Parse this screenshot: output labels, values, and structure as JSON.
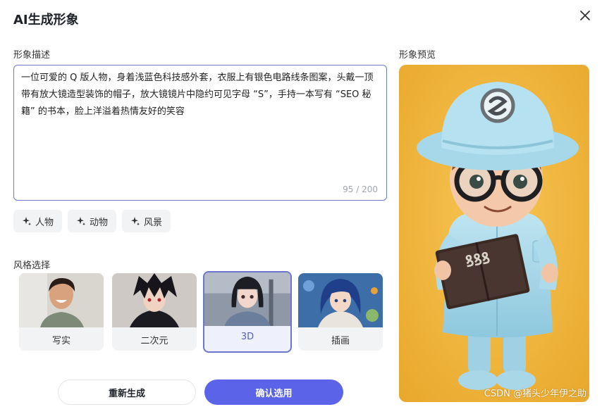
{
  "dialog": {
    "title": "AI生成形象"
  },
  "description": {
    "label": "形象描述",
    "value": "一位可爱的 Q 版人物，身着浅蓝色科技感外套，衣服上有银色电路线条图案，头戴一顶带有放大镜造型装饰的帽子，放大镜镜片中隐约可见字母 “S”，手持一本写有 “SEO 秘籍” 的书本，脸上洋溢着热情友好的笑容",
    "char_count": "95 / 200"
  },
  "chips": [
    {
      "label": "人物"
    },
    {
      "label": "动物"
    },
    {
      "label": "风景"
    }
  ],
  "style_section": {
    "label": "风格选择",
    "options": [
      {
        "label": "写实"
      },
      {
        "label": "二次元"
      },
      {
        "label": "3D",
        "selected": true
      },
      {
        "label": "插画"
      }
    ]
  },
  "preview": {
    "label": "形象预览",
    "book_text": "ꝸꝸꝸ"
  },
  "buttons": {
    "regenerate": "重新生成",
    "confirm": "确认选用"
  },
  "watermark": "CSDN @猪头少年伊之助",
  "colors": {
    "accent": "#5b63e8",
    "selected_border": "#6b76cc",
    "preview_bg": "#f0b43a"
  }
}
